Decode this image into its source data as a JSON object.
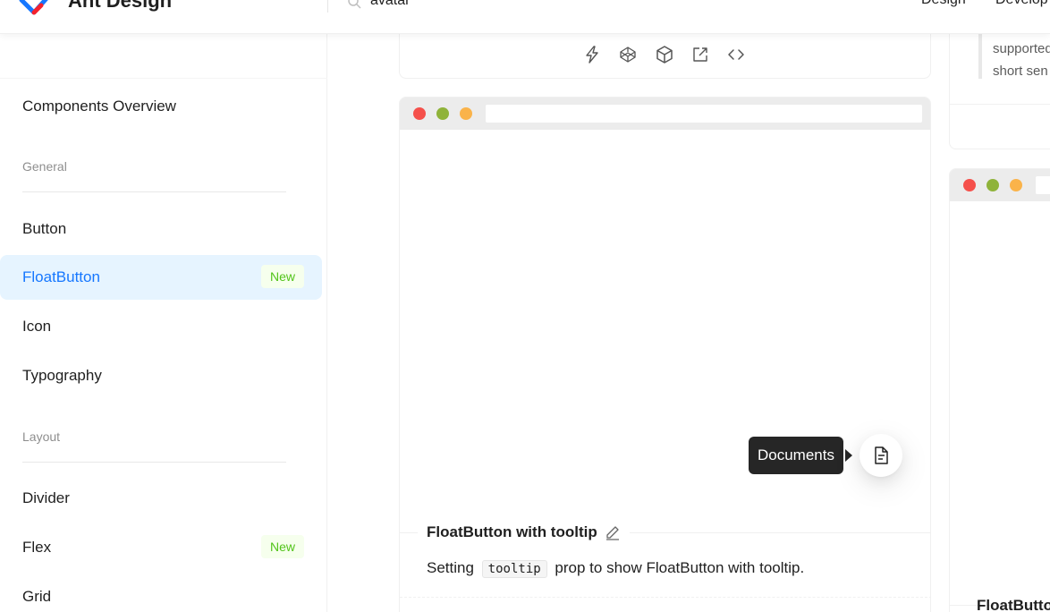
{
  "header": {
    "brand": "Ant Design",
    "search": {
      "value": "avatar",
      "placeholder": ""
    },
    "nav": [
      "Design",
      "Develop"
    ]
  },
  "sidebar": {
    "overview": "Components Overview",
    "groups": [
      {
        "title": "General",
        "items": [
          {
            "label": "Button"
          },
          {
            "label": "FloatButton",
            "badge": "New",
            "active": true
          },
          {
            "label": "Icon"
          },
          {
            "label": "Typography"
          }
        ]
      },
      {
        "title": "Layout",
        "items": [
          {
            "label": "Divider"
          },
          {
            "label": "Flex",
            "badge": "New"
          },
          {
            "label": "Grid"
          }
        ]
      }
    ]
  },
  "demo": {
    "actions": [
      "thunderbolt-icon",
      "codepen-icon",
      "codesandbox-icon",
      "external-link-icon",
      "code-icon"
    ],
    "tooltip": "Documents",
    "float_button_icon": "file-text-icon",
    "title": "FloatButton with tooltip",
    "desc_before": "Setting",
    "desc_code": "tooltip",
    "desc_after": "prop to show FloatButton with tooltip."
  },
  "right": {
    "quote_lines": [
      "supported",
      "short sen"
    ],
    "title": "FloatButto"
  },
  "colors": {
    "accent": "#1677ff",
    "active_bg": "#e6f4ff",
    "badge_green": "#52c41a",
    "dot_red": "#f5504b",
    "dot_green": "#8fb33a",
    "dot_yellow": "#fab34a"
  }
}
